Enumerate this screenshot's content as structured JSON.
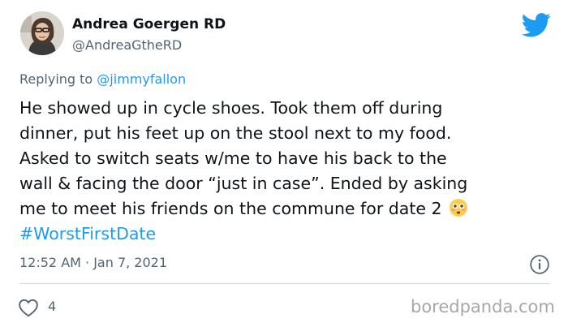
{
  "tweet": {
    "author_name": "Andrea Goergen RD",
    "author_handle": "@AndreaGtheRD",
    "replying_prefix": "Replying to ",
    "replying_to": "@jimmyfallon",
    "text_lines": [
      "He showed up in cycle shoes. Took them off during",
      "dinner, put his feet up on the stool next to my food.",
      "Asked to switch seats w/me to have his back to the",
      "wall & facing the door “just in case”. Ended by asking",
      "me to meet his friends on the commune for date 2"
    ],
    "hashtag": "#WorstFirstDate",
    "timestamp": "12:52 AM · Jan 7, 2021",
    "like_count": "4"
  },
  "watermark": "boredpanda.com",
  "icons": {
    "brand": "twitter-bird-icon",
    "emoji": "flushed-face-emoji",
    "info": "info-icon",
    "like": "heart-icon"
  },
  "colors": {
    "text_primary": "#0f1419",
    "text_secondary": "#536471",
    "link": "#1d9bf0",
    "twitter_blue": "#1d9bf0",
    "divider": "#cfd9de",
    "watermark": "#a7a7a7"
  }
}
